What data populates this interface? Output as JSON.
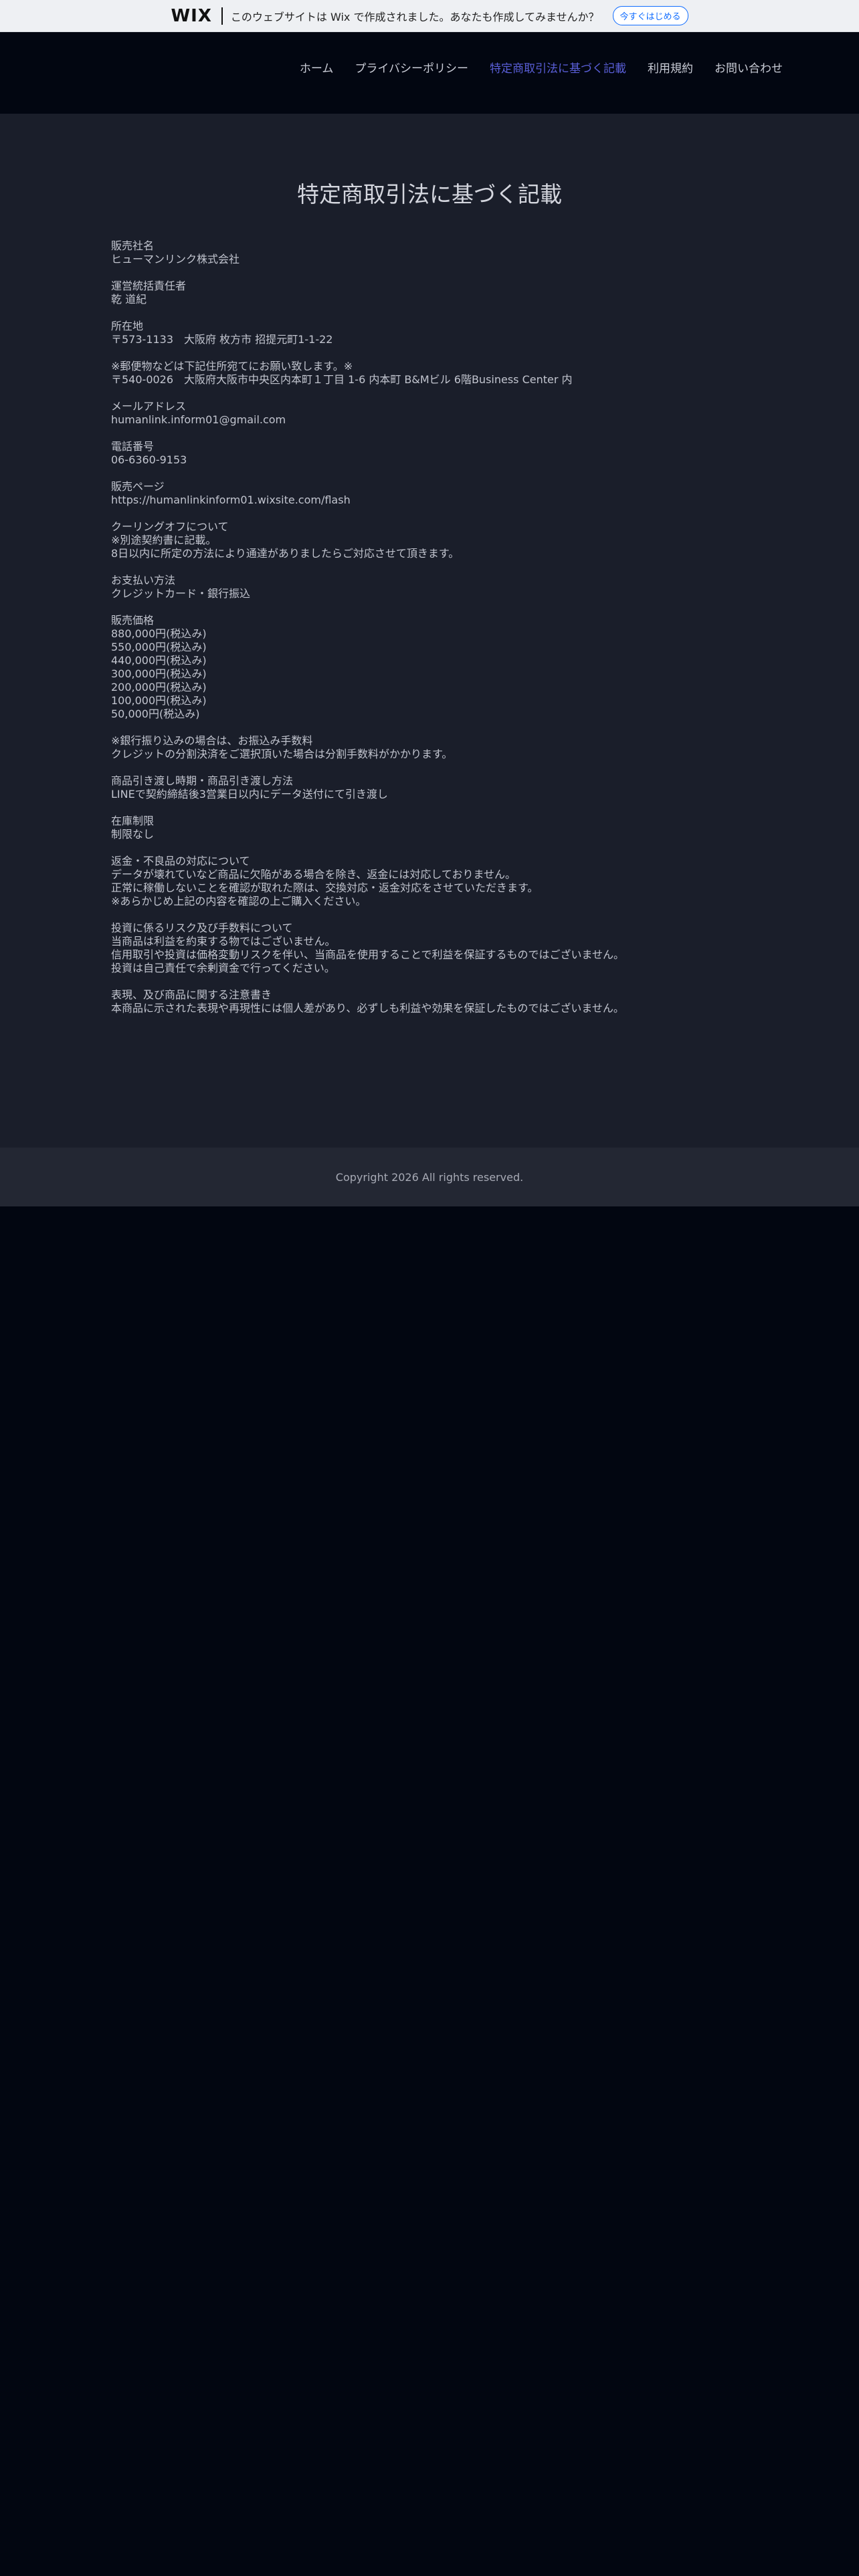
{
  "wix_banner": {
    "logo": "WIX",
    "message": "このウェブサイトは Wix で作成されました。あなたも作成してみませんか？",
    "cta": "今すぐはじめる"
  },
  "nav": {
    "items": [
      {
        "label": "ホーム"
      },
      {
        "label": "プライバシーポリシー"
      },
      {
        "label": "特定商取引法に基づく記載",
        "active": true
      },
      {
        "label": "利用規約"
      },
      {
        "label": "お問い合わせ"
      }
    ]
  },
  "page": {
    "title": "特定商取引法に基づく記載",
    "sections": [
      {
        "lines": [
          "販売社名",
          "ヒューマンリンク株式会社"
        ]
      },
      {
        "lines": [
          "運営統括責任者",
          "乾 道紀"
        ]
      },
      {
        "lines": [
          "所在地",
          "〒573-1133　大阪府 枚方市 招提元町1-1-22"
        ]
      },
      {
        "lines": [
          "※郵便物などは下記住所宛てにお願い致します。※",
          "〒540-0026　大阪府大阪市中央区内本町１丁目 1-6 内本町 B&Mビル 6階Business Center 内"
        ]
      },
      {
        "lines": [
          "メールアドレス",
          "humanlink.inform01@gmail.com"
        ]
      },
      {
        "lines": [
          "電話番号",
          "06-6360-9153"
        ]
      },
      {
        "lines": [
          "販売ページ",
          "https://humanlinkinform01.wixsite.com/flash"
        ]
      },
      {
        "lines": [
          "クーリングオフについて",
          "※別途契約書に記載。",
          "8日以内に所定の方法により通達がありましたらご対応させて頂きます。"
        ]
      },
      {
        "lines": [
          "お支払い方法",
          "クレジットカード・銀行振込"
        ]
      },
      {
        "lines": [
          "販売価格",
          "880,000円(税込み)",
          "550,000円(税込み)",
          "440,000円(税込み)",
          "300,000円(税込み)",
          "200,000円(税込み)",
          "100,000円(税込み)",
          "50,000円(税込み)"
        ]
      },
      {
        "lines": [
          "※銀行振り込みの場合は、お振込み手数料",
          "クレジットの分割決済をご選択頂いた場合は分割手数料がかかります。"
        ]
      },
      {
        "lines": [
          "商品引き渡し時期・商品引き渡し方法",
          "LINEで契約締結後3営業日以内にデータ送付にて引き渡し"
        ]
      },
      {
        "lines": [
          "在庫制限",
          "制限なし"
        ]
      },
      {
        "lines": [
          "返金・不良品の対応について",
          "データが壊れていなど商品に欠陥がある場合を除き、返金には対応しておりません。",
          "正常に稼働しないことを確認が取れた際は、交換対応・返金対応をさせていただきます。",
          "※あらかじめ上記の内容を確認の上ご購入ください。"
        ]
      },
      {
        "lines": [
          "投資に係るリスク及び手数料について",
          "当商品は利益を約束する物ではございません。",
          "信用取引や投資は価格変動リスクを伴い、当商品を使用することで利益を保証するものではございません。",
          "投資は自己責任で余剰資金で行ってください。"
        ]
      },
      {
        "lines": [
          "表現、及び商品に関する注意書き",
          "本商品に示された表現や再現性には個人差があり、必ずしも利益や効果を保証したものではございません。"
        ]
      }
    ]
  },
  "footer": {
    "copyright": "Copyright 2026 All rights reserved."
  }
}
